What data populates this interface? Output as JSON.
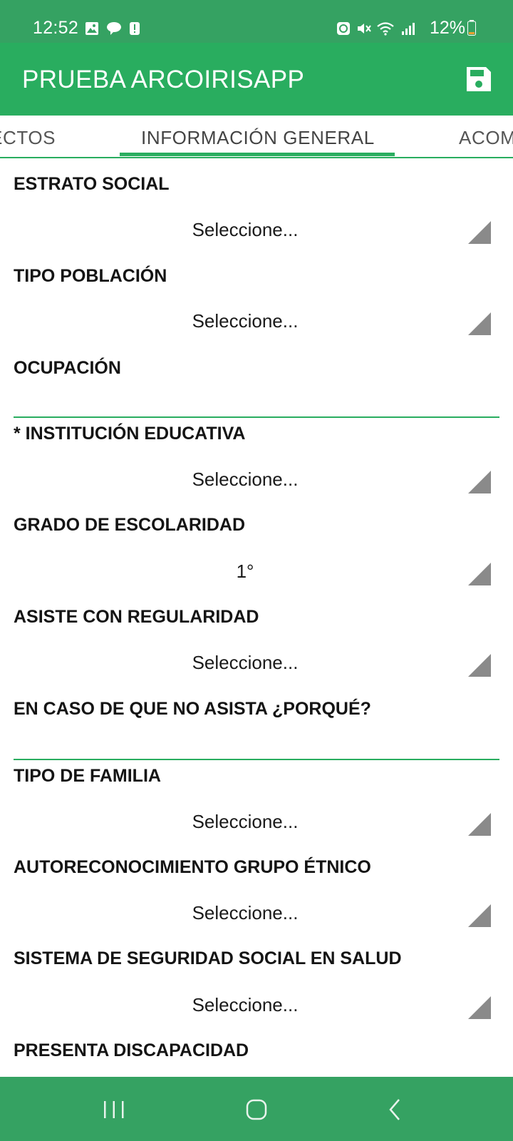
{
  "status_bar": {
    "time": "12:52",
    "battery": "12%",
    "icons": [
      "gallery-icon",
      "chat-bubble-icon",
      "alert-icon",
      "recycle-icon",
      "mute-icon",
      "wifi-icon",
      "signal-icon",
      "battery-icon"
    ]
  },
  "app_bar": {
    "title": "PRUEBA ARCOIRISAPP",
    "save_icon": "floppy-disk-icon"
  },
  "tabs": [
    {
      "label": "ECTOS"
    },
    {
      "label": "INFORMACIÓN GENERAL",
      "active": true
    },
    {
      "label": "ACOM"
    }
  ],
  "form": {
    "estrato_social": {
      "label": "ESTRATO SOCIAL",
      "value": "Seleccione..."
    },
    "tipo_poblacion": {
      "label": "TIPO POBLACIÓN",
      "value": "Seleccione..."
    },
    "ocupacion": {
      "label": "OCUPACIÓN",
      "value": ""
    },
    "institucion_educativa": {
      "label": "* INSTITUCIÓN EDUCATIVA",
      "value": "Seleccione..."
    },
    "grado_escolaridad": {
      "label": "GRADO DE ESCOLARIDAD",
      "value": "1°"
    },
    "asiste_regularidad": {
      "label": "ASISTE CON REGULARIDAD",
      "value": "Seleccione..."
    },
    "porque_no_asiste": {
      "label": "EN CASO DE QUE NO ASISTA ¿PORQUÉ?",
      "value": ""
    },
    "tipo_familia": {
      "label": "TIPO DE FAMILIA",
      "value": "Seleccione..."
    },
    "grupo_etnico": {
      "label": "AUTORECONOCIMIENTO GRUPO ÉTNICO",
      "value": "Seleccione..."
    },
    "seguridad_social": {
      "label": "SISTEMA DE SEGURIDAD SOCIAL EN SALUD",
      "value": "Seleccione..."
    },
    "discapacidad": {
      "label": "PRESENTA DISCAPACIDAD"
    }
  },
  "nav_bar": {
    "icons": [
      "recent-apps-icon",
      "home-icon",
      "back-icon"
    ]
  },
  "colors": {
    "status_bar": "#35a262",
    "app_bar": "#29ad5f",
    "accent": "#29ad5f",
    "nav_bar": "#35a262",
    "arrow": "#8a8a8a"
  }
}
